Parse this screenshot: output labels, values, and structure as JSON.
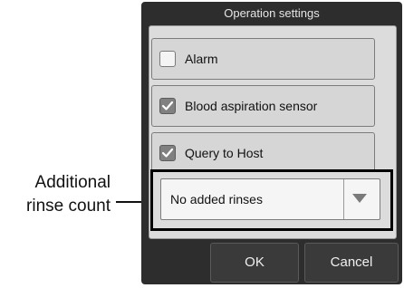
{
  "callout": {
    "line1": "Additional",
    "line2": "rinse count"
  },
  "dialog": {
    "title": "Operation settings",
    "checkboxes": [
      {
        "label": "Alarm",
        "checked": false
      },
      {
        "label": "Blood aspiration sensor",
        "checked": true
      },
      {
        "label": "Query to Host",
        "checked": true
      }
    ],
    "rinse_select": {
      "value": "No added rinses"
    },
    "buttons": {
      "ok": "OK",
      "cancel": "Cancel"
    }
  }
}
